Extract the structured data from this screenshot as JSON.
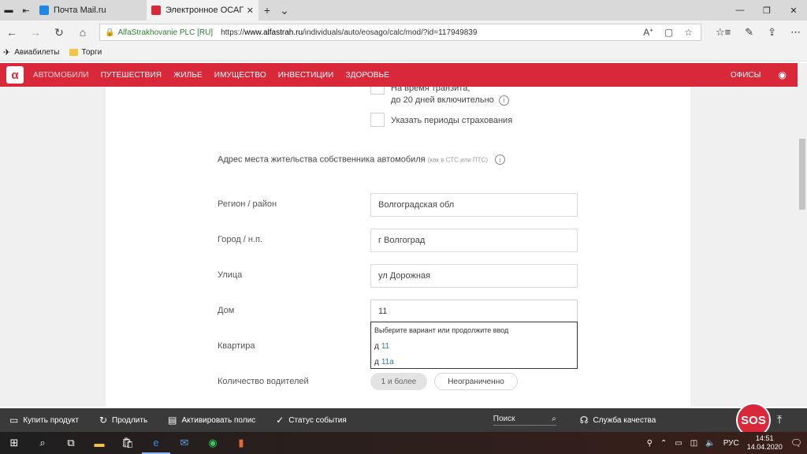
{
  "browser": {
    "tabs": [
      {
        "title": "Почта Mail.ru",
        "active": false,
        "favicon_color": "#1e88e5"
      },
      {
        "title": "Электронное ОСАГО",
        "active": true,
        "favicon_color": "#d8283a"
      }
    ],
    "address": {
      "cert_name": "AlfaStrakhovanie PLC [RU]",
      "url_prefix": "https://",
      "url_host": "www.alfastrah.ru",
      "url_path": "/individuals/auto/eosago/calc/mod/?id=117949839"
    },
    "favorites": [
      {
        "label": "Авиабилеты",
        "icon": "plane-icon"
      },
      {
        "label": "Торги",
        "icon": "folder-icon"
      }
    ]
  },
  "site_nav": {
    "logo": "α",
    "items": [
      "АВТОМОБИЛИ",
      "ПУТЕШЕСТВИЯ",
      "ЖИЛЬЕ",
      "ИМУЩЕСТВО",
      "ИНВЕСТИЦИИ",
      "ЗДОРОВЬЕ"
    ],
    "offices": "ОФИСЫ"
  },
  "form": {
    "transit_line1": "На время транзита,",
    "transit_line2": "до 20 дней включительно",
    "periods_label": "Указать периоды страхования",
    "address_section": "Адрес места жительства собственника автомобиля",
    "address_hint": "(как в СТС или ПТС)",
    "fields": {
      "region": {
        "label": "Регион / район",
        "value": "Волгоградская обл"
      },
      "city": {
        "label": "Город / н.п.",
        "value": "г Волгоград"
      },
      "street": {
        "label": "Улица",
        "value": "ул Дорожная"
      },
      "house": {
        "label": "Дом",
        "value": "11"
      },
      "apartment": {
        "label": "Квартира"
      }
    },
    "suggest": {
      "hint": "Выберите вариант или продолжите ввод",
      "options": [
        {
          "prefix": "д",
          "num": "11"
        },
        {
          "prefix": "д",
          "num": "11а"
        }
      ]
    },
    "drivers": {
      "label": "Количество водителей",
      "option_selected": "1 и более",
      "option_other": "Неограниченно"
    }
  },
  "bottom_bar": {
    "buy": "Купить продукт",
    "extend": "Продлить",
    "activate": "Активировать полис",
    "status": "Статус события",
    "search_placeholder": "Поиск",
    "quality": "Служба качества",
    "sos": "SOS"
  },
  "taskbar": {
    "lang": "РУС",
    "time": "14:51",
    "date": "14.04.2020"
  }
}
